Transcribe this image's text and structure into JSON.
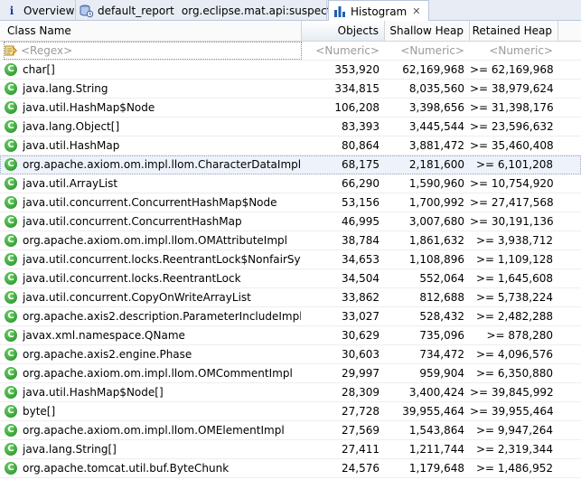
{
  "tabs": {
    "overview": "Overview",
    "report": "default_report",
    "report_sub": "org.eclipse.mat.api:suspects",
    "histogram": "Histogram"
  },
  "columns": {
    "name": "Class Name",
    "objects": "Objects",
    "shallow": "Shallow Heap",
    "retained": "Retained Heap"
  },
  "filter": {
    "name": "<Regex>",
    "objects": "<Numeric>",
    "shallow": "<Numeric>",
    "retained": "<Numeric>"
  },
  "class_icon_letter": "C",
  "rows": [
    {
      "name": "char[]",
      "objects": "353,920",
      "shallow": "62,169,968",
      "retained": ">= 62,169,968"
    },
    {
      "name": "java.lang.String",
      "objects": "334,815",
      "shallow": "8,035,560",
      "retained": ">= 38,979,624"
    },
    {
      "name": "java.util.HashMap$Node",
      "objects": "106,208",
      "shallow": "3,398,656",
      "retained": ">= 31,398,176"
    },
    {
      "name": "java.lang.Object[]",
      "objects": "83,393",
      "shallow": "3,445,544",
      "retained": ">= 23,596,632"
    },
    {
      "name": "java.util.HashMap",
      "objects": "80,864",
      "shallow": "3,881,472",
      "retained": ">= 35,460,408"
    },
    {
      "name": "org.apache.axiom.om.impl.llom.CharacterDataImpl",
      "objects": "68,175",
      "shallow": "2,181,600",
      "retained": ">= 6,101,208",
      "selected": true
    },
    {
      "name": "java.util.ArrayList",
      "objects": "66,290",
      "shallow": "1,590,960",
      "retained": ">= 10,754,920"
    },
    {
      "name": "java.util.concurrent.ConcurrentHashMap$Node",
      "objects": "53,156",
      "shallow": "1,700,992",
      "retained": ">= 27,417,568"
    },
    {
      "name": "java.util.concurrent.ConcurrentHashMap",
      "objects": "46,995",
      "shallow": "3,007,680",
      "retained": ">= 30,191,136"
    },
    {
      "name": "org.apache.axiom.om.impl.llom.OMAttributeImpl",
      "objects": "38,784",
      "shallow": "1,861,632",
      "retained": ">= 3,938,712"
    },
    {
      "name": "java.util.concurrent.locks.ReentrantLock$NonfairSync",
      "objects": "34,653",
      "shallow": "1,108,896",
      "retained": ">= 1,109,128"
    },
    {
      "name": "java.util.concurrent.locks.ReentrantLock",
      "objects": "34,504",
      "shallow": "552,064",
      "retained": ">= 1,645,608"
    },
    {
      "name": "java.util.concurrent.CopyOnWriteArrayList",
      "objects": "33,862",
      "shallow": "812,688",
      "retained": ">= 5,738,224"
    },
    {
      "name": "org.apache.axis2.description.ParameterIncludeImpl",
      "objects": "33,027",
      "shallow": "528,432",
      "retained": ">= 2,482,288"
    },
    {
      "name": "javax.xml.namespace.QName",
      "objects": "30,629",
      "shallow": "735,096",
      "retained": ">= 878,280"
    },
    {
      "name": "org.apache.axis2.engine.Phase",
      "objects": "30,603",
      "shallow": "734,472",
      "retained": ">= 4,096,576"
    },
    {
      "name": "org.apache.axiom.om.impl.llom.OMCommentImpl",
      "objects": "29,997",
      "shallow": "959,904",
      "retained": ">= 6,350,880"
    },
    {
      "name": "java.util.HashMap$Node[]",
      "objects": "28,309",
      "shallow": "3,400,424",
      "retained": ">= 39,845,992"
    },
    {
      "name": "byte[]",
      "objects": "27,728",
      "shallow": "39,955,464",
      "retained": ">= 39,955,464"
    },
    {
      "name": "org.apache.axiom.om.impl.llom.OMElementImpl",
      "objects": "27,569",
      "shallow": "1,543,864",
      "retained": ">= 9,947,264"
    },
    {
      "name": "java.lang.String[]",
      "objects": "27,411",
      "shallow": "1,211,744",
      "retained": ">= 2,319,344"
    },
    {
      "name": "org.apache.tomcat.util.buf.ByteChunk",
      "objects": "24,576",
      "shallow": "1,179,648",
      "retained": ">= 1,486,952"
    }
  ]
}
